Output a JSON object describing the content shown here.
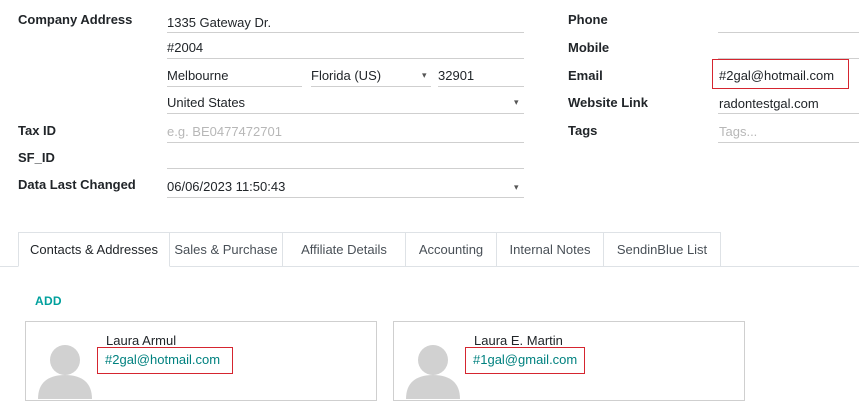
{
  "left_fields": {
    "company_address_label": "Company Address",
    "street": "1335 Gateway Dr.",
    "street2": "#2004",
    "city": "Melbourne",
    "state": "Florida (US)",
    "zip": "32901",
    "country": "United States",
    "tax_id_label": "Tax ID",
    "tax_id_placeholder": "e.g. BE0477472701",
    "sf_id_label": "SF_ID",
    "data_last_changed_label": "Data Last Changed",
    "data_last_changed_value": "06/06/2023 11:50:43"
  },
  "right_fields": {
    "phone_label": "Phone",
    "mobile_label": "Mobile",
    "email_label": "Email",
    "email_value": "#2gal@hotmail.com",
    "website_label": "Website Link",
    "website_value": "radontestgal.com",
    "tags_label": "Tags",
    "tags_placeholder": "Tags..."
  },
  "tabs": [
    {
      "label": "Contacts & Addresses"
    },
    {
      "label": "Sales & Purchase"
    },
    {
      "label": "Affiliate Details"
    },
    {
      "label": "Accounting"
    },
    {
      "label": "Internal Notes"
    },
    {
      "label": "SendinBlue List"
    }
  ],
  "contacts": {
    "add_label": "ADD",
    "items": [
      {
        "name": "Laura Armul",
        "email": "#2gal@hotmail.com"
      },
      {
        "name": "Laura E. Martin",
        "email": "#1gal@gmail.com"
      }
    ]
  },
  "colors": {
    "highlight": "#d5252f",
    "link": "#00817f",
    "accent": "#00a09d"
  }
}
